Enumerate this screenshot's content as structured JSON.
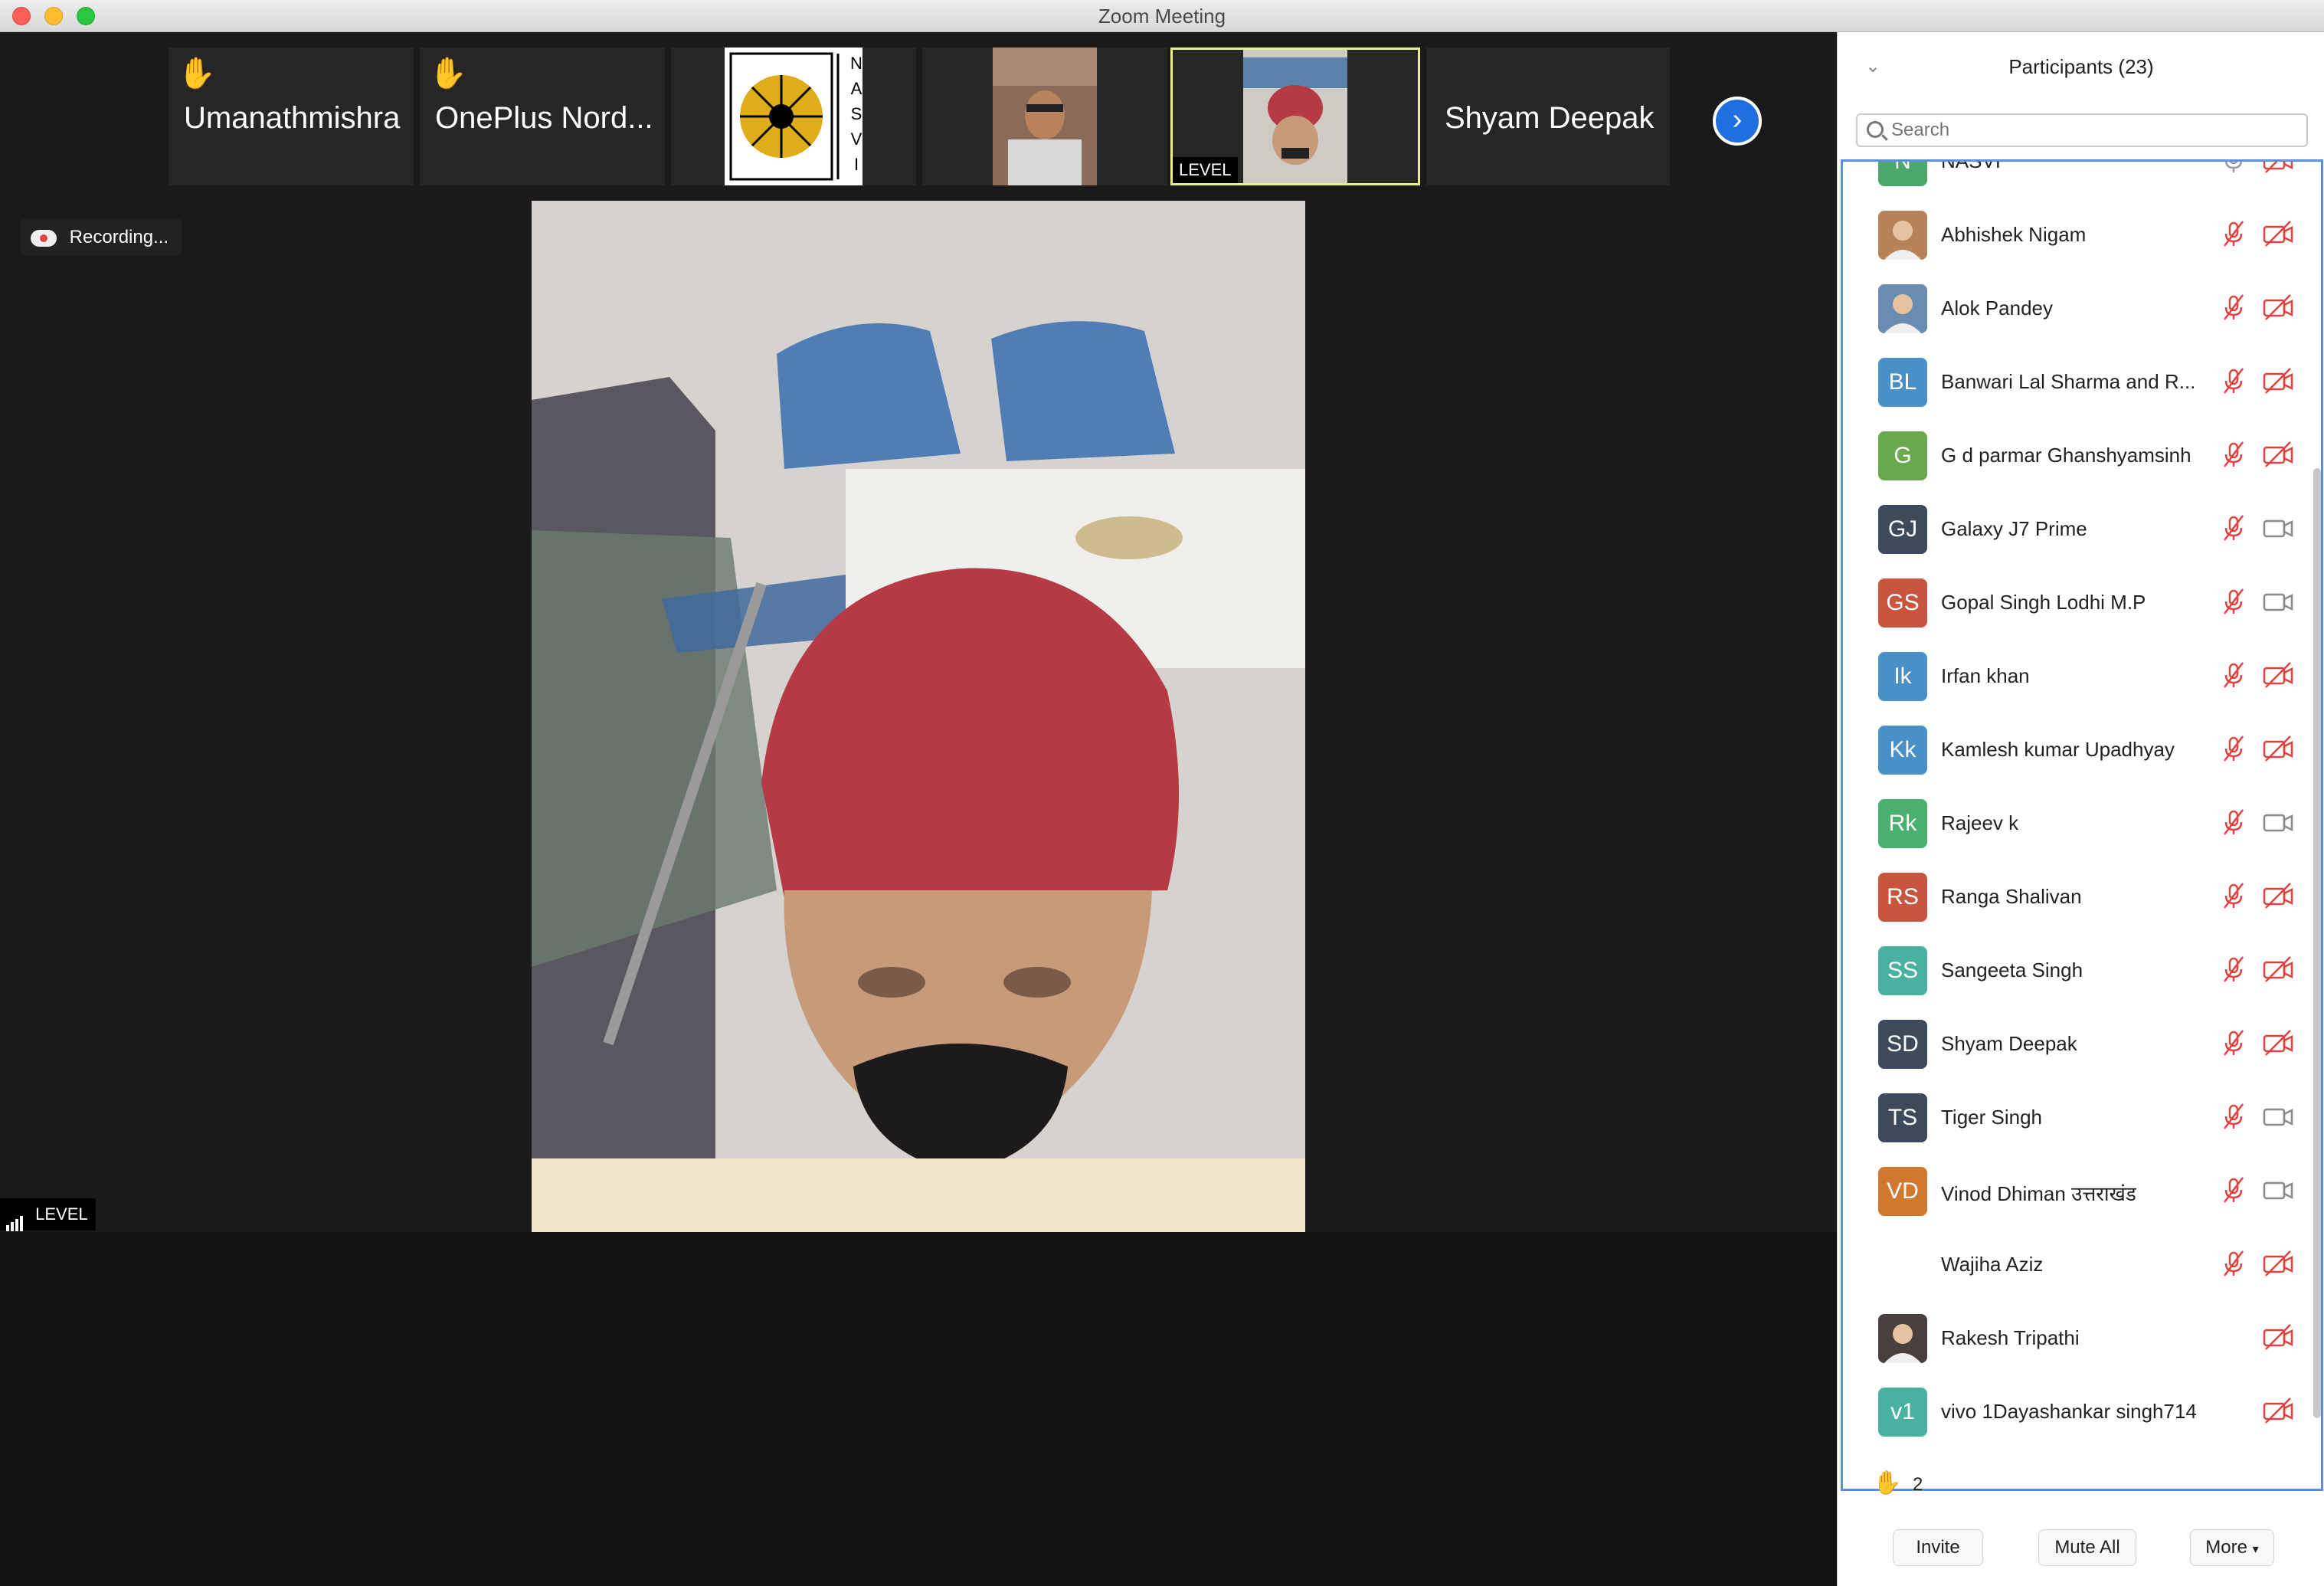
{
  "window": {
    "title": "Zoom Meeting"
  },
  "gallery_strip": {
    "tiles": [
      {
        "name": "Umanathmishra",
        "hand_raised": true
      },
      {
        "name": "OnePlus Nord...",
        "hand_raised": true
      },
      {
        "name": "NASVI",
        "logo_text": "NASVI"
      },
      {
        "name": ""
      },
      {
        "level_label": "LEVEL"
      },
      {
        "name": "Shyam Deepak"
      }
    ],
    "next_icon": "chevron-right-icon"
  },
  "main_video": {
    "recording_label": "Recording...",
    "level_label": "LEVEL"
  },
  "panel": {
    "title": "Participants (23)",
    "search_placeholder": "Search",
    "raised_hands_count": "2",
    "buttons": {
      "invite": "Invite",
      "mute_all": "Mute All",
      "more": "More"
    },
    "participants": [
      {
        "name": "NASVI",
        "initials": "N",
        "color": "#4aa86a",
        "mic": "on",
        "video": "off"
      },
      {
        "name": "Abhishek Nigam",
        "initials": "",
        "photo": true,
        "mic": "muted",
        "video": "off"
      },
      {
        "name": "Alok Pandey",
        "initials": "",
        "photo": true,
        "mic": "muted",
        "video": "off"
      },
      {
        "name": "Banwari Lal Sharma and R...",
        "initials": "BL",
        "color": "#4a90c8",
        "mic": "muted",
        "video": "off"
      },
      {
        "name": "G d parmar Ghanshyamsinh",
        "initials": "G",
        "color": "#6aa84f",
        "mic": "muted",
        "video": "off"
      },
      {
        "name": "Galaxy J7 Prime",
        "initials": "GJ",
        "color": "#3d4a5c",
        "mic": "muted",
        "video": "on"
      },
      {
        "name": "Gopal Singh Lodhi M.P",
        "initials": "GS",
        "color": "#c8563e",
        "mic": "muted",
        "video": "on"
      },
      {
        "name": "Irfan khan",
        "initials": "Ik",
        "color": "#4a90c8",
        "mic": "muted",
        "video": "off"
      },
      {
        "name": "Kamlesh kumar Upadhyay",
        "initials": "Kk",
        "color": "#4a90c8",
        "mic": "muted",
        "video": "off"
      },
      {
        "name": "Rajeev k",
        "initials": "Rk",
        "color": "#4ab070",
        "mic": "muted",
        "video": "on"
      },
      {
        "name": "Ranga Shalivan",
        "initials": "RS",
        "color": "#c8563e",
        "mic": "muted",
        "video": "off"
      },
      {
        "name": "Sangeeta Singh",
        "initials": "SS",
        "color": "#4ab0a0",
        "mic": "muted",
        "video": "off"
      },
      {
        "name": "Shyam Deepak",
        "initials": "SD",
        "color": "#3d4a5c",
        "mic": "muted",
        "video": "off"
      },
      {
        "name": "Tiger Singh",
        "initials": "TS",
        "color": "#3d4a5c",
        "mic": "muted",
        "video": "on"
      },
      {
        "name": "Vinod Dhiman  उत्तराखंड",
        "initials": "VD",
        "color": "#d0782e",
        "mic": "muted",
        "video": "on"
      },
      {
        "name": "Wajiha Aziz",
        "initials": "",
        "mic": "muted",
        "video": "off"
      },
      {
        "name": "Rakesh Tripathi",
        "initials": "",
        "photo": true,
        "mic": "none",
        "video": "off"
      },
      {
        "name": "vivo 1Dayashankar singh714",
        "initials": "v1",
        "color": "#4ab0a0",
        "mic": "none",
        "video": "off"
      }
    ]
  }
}
